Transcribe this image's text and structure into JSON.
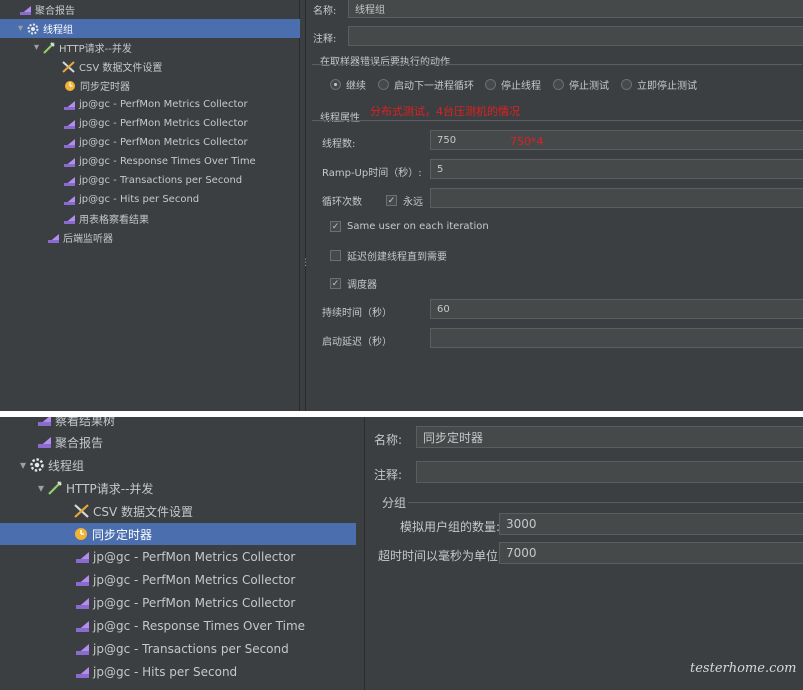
{
  "top": {
    "tree": [
      {
        "label": "聚合报告",
        "icon": "report-icon"
      },
      {
        "label": "线程组",
        "icon": "gear-icon",
        "expanded": true
      },
      {
        "label": "HTTP请求--并发",
        "icon": "pipette-icon",
        "expanded": true
      },
      {
        "label": "CSV 数据文件设置",
        "icon": "csv-tools-icon"
      },
      {
        "label": "同步定时器",
        "icon": "timer-icon"
      },
      {
        "label": "jp@gc - PerfMon Metrics Collector",
        "icon": "report-icon"
      },
      {
        "label": "jp@gc - PerfMon Metrics Collector",
        "icon": "report-icon"
      },
      {
        "label": "jp@gc - PerfMon Metrics Collector",
        "icon": "report-icon"
      },
      {
        "label": "jp@gc - Response Times Over Time",
        "icon": "report-icon"
      },
      {
        "label": "jp@gc - Transactions per Second",
        "icon": "report-icon"
      },
      {
        "label": "jp@gc - Hits per Second",
        "icon": "report-icon"
      },
      {
        "label": "用表格察看结果",
        "icon": "report-icon"
      },
      {
        "label": "后端监听器",
        "icon": "report-icon"
      }
    ],
    "form": {
      "name_label": "名称:",
      "name_value": "线程组",
      "comment_label": "注释:",
      "comment_value": "",
      "error_action_title": "在取样器错误后要执行的动作",
      "error_actions": [
        "继续",
        "启动下一进程循环",
        "停止线程",
        "停止测试",
        "立即停止测试"
      ],
      "error_action_selected": "继续",
      "thread_props_title": "线程属性",
      "annotation_distributed": "分布式测试，4台压测机的情况",
      "threads_label": "线程数:",
      "threads_value": "750",
      "annotation_threads": "750*4",
      "rampup_label": "Ramp-Up时间（秒）:",
      "rampup_value": "5",
      "loop_label": "循环次数",
      "loop_forever_label": "永远",
      "loop_forever_checked": true,
      "loop_value": "",
      "same_user_label": "Same user on each iteration",
      "same_user_checked": true,
      "delay_create_label": "延迟创建线程直到需要",
      "delay_create_checked": false,
      "scheduler_label": "调度器",
      "scheduler_checked": true,
      "duration_label": "持续时间（秒）",
      "duration_value": "60",
      "startup_delay_label": "启动延迟（秒）",
      "startup_delay_value": ""
    }
  },
  "bottom": {
    "tree": [
      {
        "label": "察看结果树",
        "icon": "report-icon"
      },
      {
        "label": "聚合报告",
        "icon": "report-icon"
      },
      {
        "label": "线程组",
        "icon": "gear-icon",
        "expanded": true
      },
      {
        "label": "HTTP请求--并发",
        "icon": "pipette-icon",
        "expanded": true
      },
      {
        "label": "CSV 数据文件设置",
        "icon": "csv-tools-icon"
      },
      {
        "label": "同步定时器",
        "icon": "timer-icon",
        "selected": true
      },
      {
        "label": "jp@gc - PerfMon Metrics Collector",
        "icon": "report-icon"
      },
      {
        "label": "jp@gc - PerfMon Metrics Collector",
        "icon": "report-icon"
      },
      {
        "label": "jp@gc - PerfMon Metrics Collector",
        "icon": "report-icon"
      },
      {
        "label": "jp@gc - Response Times Over Time",
        "icon": "report-icon"
      },
      {
        "label": "jp@gc - Transactions per Second",
        "icon": "report-icon"
      },
      {
        "label": "jp@gc - Hits per Second",
        "icon": "report-icon"
      }
    ],
    "form": {
      "name_label": "名称:",
      "name_value": "同步定时器",
      "comment_label": "注释:",
      "comment_value": "",
      "group_title": "分组",
      "users_label": "模拟用户组的数量:",
      "users_value": "3000",
      "timeout_label": "超时时间以毫秒为单位:",
      "timeout_value": "7000"
    }
  },
  "watermark": "testerhome.com",
  "colors": {
    "panel_bg": "#3c3f41",
    "selection": "#4b6eaf",
    "annotation": "#e02020"
  }
}
